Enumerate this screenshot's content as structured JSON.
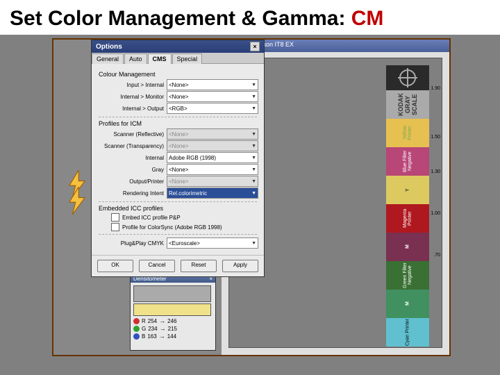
{
  "slide": {
    "title_a": "Set Color Management & Gamma: ",
    "title_b": "CM"
  },
  "app": {
    "title": "SilverFast Epson IT8 EX"
  },
  "dialog": {
    "title": "Options",
    "tabs": [
      "General",
      "Auto",
      "CMS",
      "Special"
    ],
    "active_tab": 2,
    "section_cm": "Colour Management",
    "rows_cm": [
      {
        "label": "Input > Internal",
        "value": "<None>"
      },
      {
        "label": "Internal > Monitor",
        "value": "<None>"
      },
      {
        "label": "Internal > Output",
        "value": "<RGB>"
      }
    ],
    "section_prof": "Profiles for ICM",
    "rows_prof": [
      {
        "label": "Scanner (Reflective)",
        "value": "<None>",
        "disabled": true
      },
      {
        "label": "Scanner (Transparency)",
        "value": "<None>",
        "disabled": true
      },
      {
        "label": "Internal",
        "value": "Adobe RGB (1998)"
      },
      {
        "label": "Gray",
        "value": "<None>"
      },
      {
        "label": "Output/Printer",
        "value": "<None>",
        "disabled": true
      },
      {
        "label": "Rendering Intent",
        "value": "Rel.colorimetric",
        "highlight": true
      }
    ],
    "section_emb": "Embedded ICC profiles",
    "chk1": "Embed ICC profile P&P",
    "chk2": "Profile for ColorSync (Adobe RGB 1998)",
    "pnp_label": "Plug&Play CMYK",
    "pnp_value": "<Euroscale>",
    "buttons": [
      "OK",
      "Cancel",
      "Reset",
      "Apply"
    ]
  },
  "densito": {
    "title": "Densitometer",
    "rows": [
      {
        "c": "R",
        "a": "254",
        "b": "246"
      },
      {
        "c": "G",
        "a": "234",
        "b": "215"
      },
      {
        "c": "B",
        "a": "163",
        "b": "144"
      }
    ]
  },
  "strip": {
    "kodak": "KODAK GRAY SCALE",
    "segs": [
      "Yellow Printer",
      "Blue Filter Negative",
      "Y",
      "Magenta Printer",
      "M",
      "Green Filter Negative",
      "M",
      "Cyan Printer"
    ],
    "nums": [
      "1.90",
      "1.50",
      "1.30",
      "1.00",
      ".70"
    ]
  }
}
